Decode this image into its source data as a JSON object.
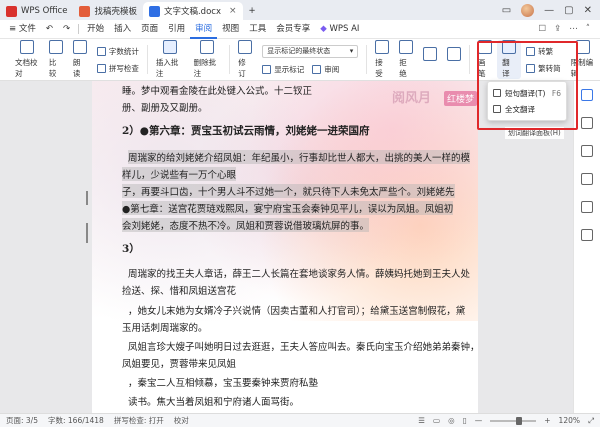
{
  "tabs": [
    {
      "label": "WPS Office",
      "icon_color": "#d9322e"
    },
    {
      "label": "找稿壳模板",
      "icon_color": "#e35d3a"
    },
    {
      "label": "文字文稿.docx",
      "icon_color": "#2f6fe4"
    }
  ],
  "menubar": {
    "file": "文件",
    "items": [
      "开始",
      "插入",
      "页面",
      "引用",
      "审阅",
      "视图",
      "工具",
      "会员专享"
    ],
    "active": "审阅",
    "ai": "WPS AI"
  },
  "ribbon": {
    "doc_check": "文档校对",
    "compare": "比较",
    "read": "朗读",
    "word_count": "字数统计",
    "spell_check": "拼写检查",
    "insert_comment": "插入批注",
    "delete_comment": "删除批注",
    "revise": "修订",
    "show_markup_select": "显示标记的最终状态",
    "show_markup": "显示标记",
    "review": "审阅",
    "accept": "接受",
    "reject": "拒绝",
    "edit_restriction": "限制编辑",
    "compare2": "画笔",
    "translate": "翻译",
    "convert_tc": "转繁",
    "convert_sc": "繁转简"
  },
  "dropdown": {
    "items": [
      {
        "label": "短句翻译(T)",
        "shortcut": "F6"
      },
      {
        "label": "全文翻译",
        "shortcut": ""
      }
    ],
    "tip": "划词翻译面板(H)"
  },
  "document": {
    "lines": [
      "睡。梦中观看金陵在此处键入公式。十二钗正",
      "册、副册及又副册。",
      "2）●第六章：贾宝玉初试云雨情，刘姥姥一进荣国府",
      "周瑞家的给刘姥姥介绍凤姐：年纪虽小，行事却比世人都大，出挑的美人一样的模",
      "样儿，少说些有一万个心眼",
      "子，再要斗口齿，十个男人斗不过她一个，就只待下人未免太严些个。刘姥姥先",
      "●第七章：送宫花贾琏戏熙凤，宴宁府宝玉会秦钟见平儿，误以为凤姐。凤姐初",
      "会刘姥姥，态度不热不冷。凤姐和贾蓉说借玻璃炕屏的事。",
      "3）",
      "周瑞家的找王夫人章话，薛王二人长篇在套地谈家务人情。薛姨妈托她到王夫人处",
      "捡送、探、惜和凤姐送宫花",
      "，她女儿末她为女婿冷子兴说情（因卖古董和人打官司）；给黛玉送宫制假花，黛",
      "玉用话刺周瑞家的。",
      "凤姐言珍大嫂子叫她明日过去逛逛，王夫人答应叫去。秦氏向宝玉介绍她弟弟秦钟，",
      "凤姐要见，贾蓉带来见凤姐",
      "，秦宝二人互相倾慕，宝玉要秦钟来贾府私塾",
      "读书。焦大当着凤姐和宁府诸人面骂街。"
    ],
    "watermark": "阅风月",
    "watermark_badge": "红楼梦"
  },
  "statusbar": {
    "page": "页面: 3/5",
    "words": "字数: 166/1418",
    "spell": "拼写检查: 打开",
    "doc_check": "校对",
    "zoom": "120%"
  },
  "colors": {
    "accent": "#2b6de0",
    "highlight_box": "#e0282b"
  }
}
